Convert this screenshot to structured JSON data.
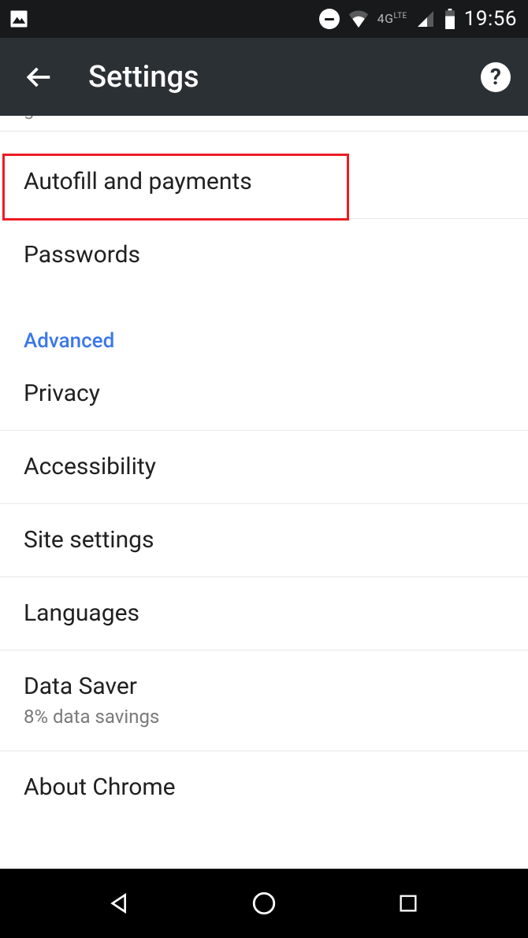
{
  "status": {
    "time": "19:56",
    "network_label": "4G LTE"
  },
  "appbar": {
    "title": "Settings"
  },
  "scroll_fragment": "g",
  "items": {
    "autofill": "Autofill and payments",
    "passwords": "Passwords"
  },
  "section": {
    "advanced": "Advanced"
  },
  "adv_items": {
    "privacy": "Privacy",
    "accessibility": "Accessibility",
    "site_settings": "Site settings",
    "languages": "Languages",
    "data_saver": "Data Saver",
    "data_saver_sub": "8% data savings",
    "about": "About Chrome"
  }
}
